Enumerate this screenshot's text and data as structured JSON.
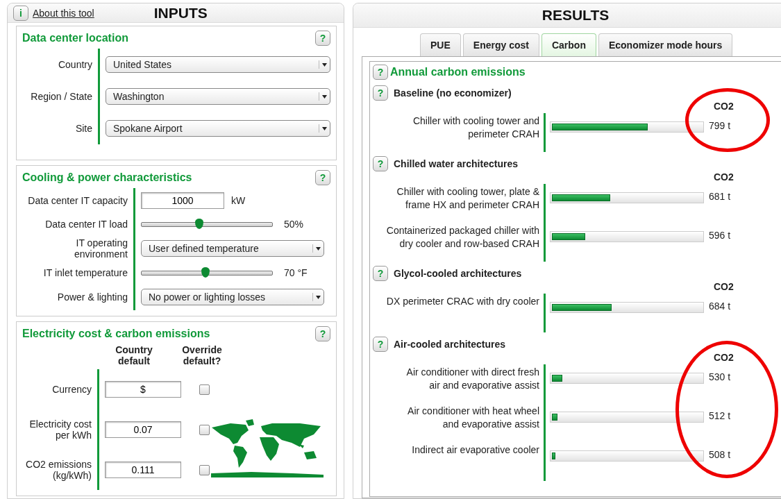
{
  "inputs": {
    "about_icon": "i",
    "about_link": "About this tool",
    "title": "INPUTS",
    "location": {
      "title": "Data center location",
      "help": "?",
      "fields": [
        {
          "label": "Country",
          "value": "United States"
        },
        {
          "label": "Region / State",
          "value": "Washington"
        },
        {
          "label": "Site",
          "value": "Spokane Airport"
        }
      ]
    },
    "cooling": {
      "title": "Cooling & power characteristics",
      "help": "?",
      "rows": [
        {
          "kind": "text",
          "label": "Data center IT capacity",
          "value": "1000",
          "unit": "kW"
        },
        {
          "kind": "slider",
          "label": "Data center IT load",
          "level": 0.44,
          "reading": "50%"
        },
        {
          "kind": "select",
          "label": "IT operating environment",
          "value": "User defined temperature"
        },
        {
          "kind": "slider",
          "label": "IT inlet temperature",
          "level": 0.49,
          "reading": "70 °F"
        },
        {
          "kind": "select",
          "label": "Power & lighting",
          "value": "No power or lighting losses"
        }
      ]
    },
    "electricity": {
      "title": "Electricity cost & carbon emissions",
      "help": "?",
      "column_headers": [
        "Country default",
        "Override default?"
      ],
      "rows": [
        {
          "label": "Currency",
          "value": "$",
          "checked": false
        },
        {
          "label": "Electricity cost per kWh",
          "value": "0.07",
          "checked": false
        },
        {
          "label": "CO2 emissions (kg/kWh)",
          "value": "0.111",
          "checked": false
        }
      ]
    }
  },
  "results": {
    "title": "RESULTS",
    "tabs": [
      {
        "label": "PUE",
        "selected": false
      },
      {
        "label": "Energy cost",
        "selected": false
      },
      {
        "label": "Carbon",
        "selected": true
      },
      {
        "label": "Economizer mode hours",
        "selected": false
      }
    ],
    "section": {
      "help": "?",
      "title": "Annual carbon emissions"
    },
    "groups": [
      {
        "help": "?",
        "title": "Baseline (no economizer)",
        "value_header": "CO2",
        "circled": true,
        "rows": [
          {
            "label": "Chiller with cooling tower and\nperimeter CRAH",
            "level": 0.64,
            "reading": "799 t"
          }
        ]
      },
      {
        "help": "?",
        "title": "Chilled water architectures",
        "value_header": "CO2",
        "circled": false,
        "rows": [
          {
            "label": "Chiller with cooling tower, plate &\nframe HX and perimeter CRAH",
            "level": 0.39,
            "reading": "681 t"
          },
          {
            "label": "Containerized packaged chiller with\ndry cooler and row-based CRAH",
            "level": 0.22,
            "reading": "596 t"
          }
        ]
      },
      {
        "help": "?",
        "title": "Glycol-cooled architectures",
        "value_header": "CO2",
        "circled": false,
        "rows": [
          {
            "label": "DX perimeter CRAC with dry cooler",
            "level": 0.4,
            "reading": "684 t"
          }
        ]
      },
      {
        "help": "?",
        "title": "Air-cooled architectures",
        "value_header": "CO2",
        "circled": true,
        "rows": [
          {
            "label": "Air conditioner with direct fresh\nair and evaporative assist",
            "level": 0.07,
            "reading": "530 t"
          },
          {
            "label": "Air conditioner with heat wheel\nand evaporative assist",
            "level": 0.035,
            "reading": "512 t"
          },
          {
            "label": "Indirect air evaporative cooler",
            "level": 0.025,
            "reading": "508 t"
          }
        ]
      }
    ]
  }
}
